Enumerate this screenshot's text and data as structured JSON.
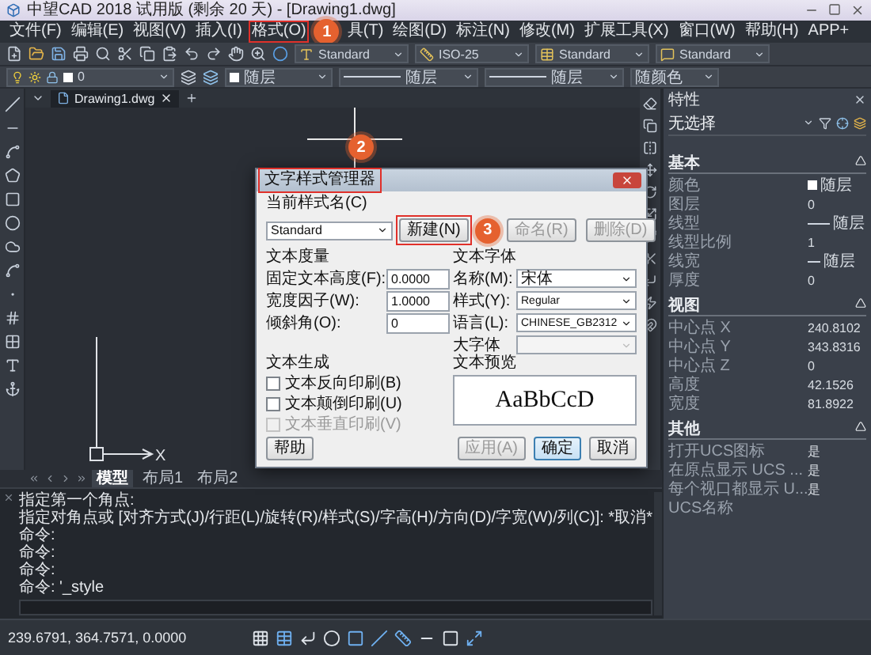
{
  "window": {
    "title": "中望CAD 2018 试用版 (剩余 20 天) - [Drawing1.dwg]"
  },
  "menu": [
    {
      "label": "文件(F)",
      "highlighted": false
    },
    {
      "label": "编辑(E)",
      "highlighted": false
    },
    {
      "label": "视图(V)",
      "highlighted": false
    },
    {
      "label": "插入(I)",
      "highlighted": false
    },
    {
      "label": "格式(O)",
      "highlighted": true,
      "badge": "1"
    },
    {
      "label": "具(T)",
      "highlighted": false
    },
    {
      "label": "绘图(D)",
      "highlighted": false
    },
    {
      "label": "标注(N)",
      "highlighted": false
    },
    {
      "label": "修改(M)",
      "highlighted": false
    },
    {
      "label": "扩展工具(X)",
      "highlighted": false
    },
    {
      "label": "窗口(W)",
      "highlighted": false
    },
    {
      "label": "帮助(H)",
      "highlighted": false
    },
    {
      "label": "APP+",
      "highlighted": false
    }
  ],
  "style_toolbar": [
    {
      "kind": "text",
      "value": "Standard"
    },
    {
      "kind": "dimension",
      "value": "ISO-25"
    },
    {
      "kind": "table",
      "value": "Standard"
    },
    {
      "kind": "multileader",
      "value": "Standard"
    }
  ],
  "layer_bar": {
    "layer": "0",
    "color_setting": "随层",
    "linetype": "随层",
    "lineweight": "随层",
    "plot_style": "随颜色"
  },
  "document_tabs": [
    {
      "label": "Drawing1.dwg",
      "selected": true
    }
  ],
  "ucs_icon": {
    "x_label": "X"
  },
  "layout_tabs": [
    {
      "label": "模型",
      "selected": true
    },
    {
      "label": "布局1",
      "selected": false
    },
    {
      "label": "布局2",
      "selected": false
    }
  ],
  "command_history": [
    "指定第一个角点:",
    "指定对角点或 [对齐方式(J)/行距(L)/旋转(R)/样式(S)/字高(H)/方向(D)/字宽(W)/列(C)]: *取消*",
    "命令:",
    "命令:",
    "命令:",
    "命令: '_style"
  ],
  "status_bar": {
    "coordinates": "239.6791, 364.7571, 0.0000"
  },
  "properties": {
    "title": "特性",
    "selection": "无选择",
    "sections": [
      {
        "title": "基本",
        "expanded": true,
        "rows": [
          {
            "label": "颜色",
            "value": "随层",
            "kind": "swatch"
          },
          {
            "label": "图层",
            "value": "0",
            "kind": "plain"
          },
          {
            "label": "线型",
            "value": "随层",
            "kind": "long_line"
          },
          {
            "label": "线型比例",
            "value": "1",
            "kind": "plain"
          },
          {
            "label": "线宽",
            "value": "随层",
            "kind": "short_line"
          },
          {
            "label": "厚度",
            "value": "0",
            "kind": "plain"
          }
        ]
      },
      {
        "title": "视图",
        "expanded": true,
        "rows": [
          {
            "label": "中心点 X",
            "value": "240.8102",
            "kind": "plain"
          },
          {
            "label": "中心点 Y",
            "value": "343.8316",
            "kind": "plain"
          },
          {
            "label": "中心点 Z",
            "value": "0",
            "kind": "plain"
          },
          {
            "label": "高度",
            "value": "42.1526",
            "kind": "plain"
          },
          {
            "label": "宽度",
            "value": "81.8922",
            "kind": "plain"
          }
        ]
      },
      {
        "title": "其他",
        "expanded": true,
        "rows": [
          {
            "label": "打开UCS图标",
            "value": "是",
            "kind": "plain"
          },
          {
            "label": "在原点显示 UCS ...",
            "value": "是",
            "kind": "plain"
          },
          {
            "label": "每个视口都显示 U...",
            "value": "是",
            "kind": "plain"
          },
          {
            "label": "UCS名称",
            "kind": "plain"
          }
        ]
      }
    ]
  },
  "dialog": {
    "title": "文字样式管理器",
    "highlighted": true,
    "badge": "2",
    "current_style_label": "当前样式名(C)",
    "current_style": "Standard",
    "style_buttons": [
      {
        "label": "新建(N)",
        "disabled": false,
        "highlighted": true,
        "badge": "3"
      },
      {
        "label": "命名(R)",
        "disabled": true,
        "highlighted": false
      },
      {
        "label": "删除(D)",
        "disabled": true,
        "highlighted": false
      }
    ],
    "metrics": {
      "title": "文本度量",
      "fields": [
        {
          "label": "固定文本高度(F):",
          "value": "0.0000"
        },
        {
          "label": "宽度因子(W):",
          "value": "1.0000"
        },
        {
          "label": "倾斜角(O):",
          "value": "0"
        }
      ]
    },
    "font": {
      "title": "文本字体",
      "fields": [
        {
          "label": "名称(M):",
          "value": "宋体",
          "disabled": false
        },
        {
          "label": "样式(Y):",
          "value": "Regular",
          "disabled": false
        },
        {
          "label": "语言(L):",
          "value": "CHINESE_GB2312",
          "disabled": false
        },
        {
          "label": "大字体",
          "disabled": true
        }
      ]
    },
    "generation": {
      "title": "文本生成",
      "options": [
        {
          "label": "文本反向印刷(B)",
          "checked": false,
          "disabled": false
        },
        {
          "label": "文本颠倒印刷(U)",
          "checked": false,
          "disabled": false
        },
        {
          "label": "文本垂直印刷(V)",
          "checked": false,
          "disabled": true
        }
      ]
    },
    "preview": {
      "title": "文本预览",
      "sample": "AaBbCcD"
    },
    "buttons": [
      {
        "label": "帮助",
        "kind": "help",
        "disabled": false,
        "default": false
      },
      {
        "label": "应用(A)",
        "kind": "action",
        "disabled": true,
        "default": false
      },
      {
        "label": "确定",
        "kind": "action",
        "disabled": false,
        "default": true
      },
      {
        "label": "取消",
        "kind": "action",
        "disabled": false,
        "default": false
      }
    ]
  }
}
